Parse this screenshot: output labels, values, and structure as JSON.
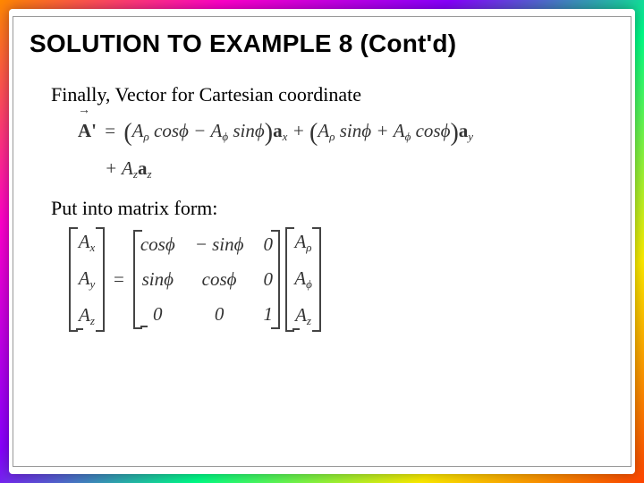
{
  "title": "SOLUTION TO EXAMPLE 8 (Cont'd)",
  "text1": "Finally, Vector for Cartesian coordinate",
  "formula": {
    "lhs": "A'",
    "t_ax": "a",
    "t_ay": "a",
    "t_az": "a",
    "sub_x": "x",
    "sub_y": "y",
    "sub_z": "z",
    "Arho1": "A",
    "sub_rho": "ρ",
    "cos": "cos",
    "phi": "ϕ",
    "minus": "−",
    "plus": "+",
    "Aphi1": "A",
    "sub_phi": "ϕ",
    "sin": "sin",
    "Az": "A"
  },
  "text2": "Put into matrix form:",
  "matrix": {
    "lhs": [
      "A",
      "A",
      "A"
    ],
    "lhs_sub": [
      "x",
      "y",
      "z"
    ],
    "eq": "=",
    "rot": [
      [
        "cosϕ",
        "− sinϕ",
        "0"
      ],
      [
        "sinϕ",
        "cosϕ",
        "0"
      ],
      [
        "0",
        "0",
        "1"
      ]
    ],
    "rhs": [
      "A",
      "A",
      "A"
    ],
    "rhs_sub": [
      "ρ",
      "ϕ",
      "z"
    ]
  }
}
